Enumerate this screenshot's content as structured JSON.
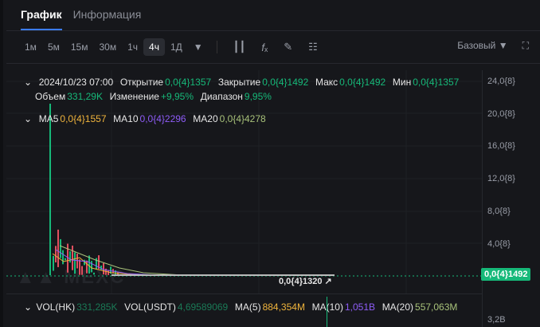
{
  "tabs": [
    {
      "label": "График",
      "active": true
    },
    {
      "label": "Информация",
      "active": false
    }
  ],
  "timeframes": [
    {
      "label": "1м"
    },
    {
      "label": "5м"
    },
    {
      "label": "15м"
    },
    {
      "label": "30м"
    },
    {
      "label": "1ч"
    },
    {
      "label": "4ч",
      "active": true
    },
    {
      "label": "1Д"
    }
  ],
  "chart_type_label": "Базовый",
  "ohlc": {
    "date": "2024/10/23 07:00",
    "open_label": "Открытие",
    "open": "0,0{4}1357",
    "close_label": "Закрытие",
    "close": "0,0{4}1492",
    "high_label": "Макс",
    "high": "0,0{4}1492",
    "low_label": "Мин",
    "low": "0,0{4}1357",
    "vol_label": "Объем",
    "vol": "331,29K",
    "change_label": "Изменение",
    "change": "+9,95%",
    "range_label": "Диапазон",
    "range": "9,95%"
  },
  "ma": {
    "ma5_label": "MA5",
    "ma5": "0,0{4}1557",
    "ma10_label": "MA10",
    "ma10": "0,0{4}2296",
    "ma20_label": "MA20",
    "ma20": "0,0{4}4278"
  },
  "y_axis": [
    "24,0{8}",
    "20,0{8}",
    "16,0{8}",
    "12,0{8}",
    "8,0{8}",
    "4,0{8}"
  ],
  "current_price": "0,0{4}1492",
  "min_marker": "0,0{4}1320",
  "watermark": "MEXC",
  "volume": {
    "hk_label": "VOL(HK)",
    "hk": "331,285K",
    "usdt_label": "VOL(USDT)",
    "usdt": "4,69589069",
    "ma5_label": "MA(5)",
    "ma5": "884,354M",
    "ma10_label": "MA(10)",
    "ma10": "1,051B",
    "ma20_label": "MA(20)",
    "ma20": "557,063M",
    "axis": "3,2B"
  },
  "colors": {
    "up": "#16b979",
    "down": "#e04f5f",
    "accent": "#3b7cf5"
  }
}
